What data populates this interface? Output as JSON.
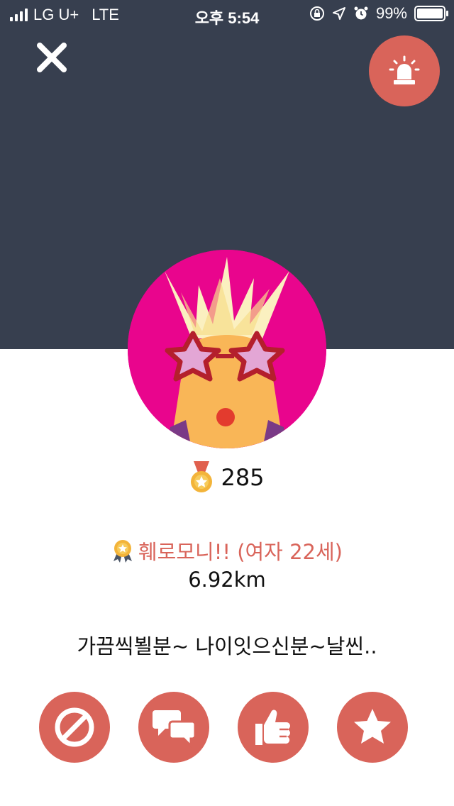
{
  "status_bar": {
    "carrier": "LG U+",
    "network": "LTE",
    "time": "오후 5:54",
    "battery": "99%",
    "battery_level": 0.99
  },
  "header": {
    "close_icon": "close-x-icon",
    "report_icon": "siren-alarm-icon",
    "background": "#373f4f",
    "accent": "#d9645a"
  },
  "profile": {
    "avatar_icon": "punk-star-glasses-avatar",
    "points": "285",
    "name_age": "훼로모니!! (여자 22세)",
    "distance": "6.92km",
    "message": "가끔씩뵐분~ 나이잇으신분~날씬.."
  },
  "actions": [
    {
      "icon": "block-icon"
    },
    {
      "icon": "chat-bubbles-icon"
    },
    {
      "icon": "thumbs-up-icon"
    },
    {
      "icon": "star-icon"
    }
  ]
}
